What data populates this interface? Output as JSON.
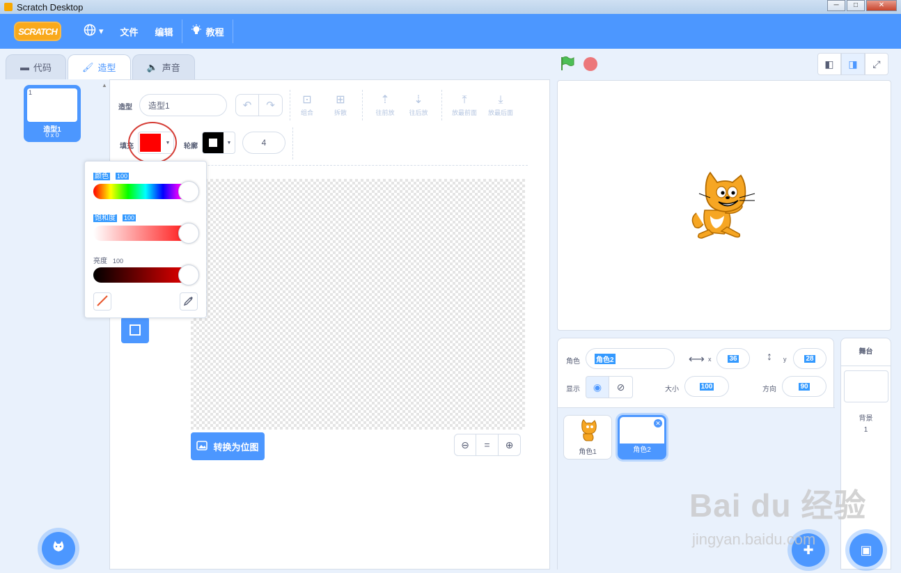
{
  "window": {
    "title": "Scratch Desktop",
    "controls": [
      "─",
      "□",
      "✕"
    ]
  },
  "menu": {
    "logo": "SCRATCH",
    "globe_caret": "▾",
    "file": "文件",
    "edit": "编辑",
    "tutorial": "教程"
  },
  "tabs": [
    {
      "label": "代码",
      "icon": "code-icon"
    },
    {
      "label": "造型",
      "icon": "brush-icon"
    },
    {
      "label": "声音",
      "icon": "speaker-icon"
    }
  ],
  "costumes": [
    {
      "num": "1",
      "name": "造型1",
      "size": "0 x 0"
    }
  ],
  "editor": {
    "costume_label": "造型",
    "costume_name": "造型1",
    "tools": [
      {
        "label": "组合",
        "icon": "group-icon"
      },
      {
        "label": "拆散",
        "icon": "ungroup-icon"
      },
      {
        "label": "往前放",
        "icon": "forward-icon"
      },
      {
        "label": "往后放",
        "icon": "backward-icon"
      },
      {
        "label": "放最前面",
        "icon": "front-icon"
      },
      {
        "label": "放最后面",
        "icon": "back-icon"
      }
    ],
    "fill_label": "填充",
    "fill_color": "#ff0000",
    "outline_label": "轮廓",
    "outline_color": "#000000",
    "outline_width": "4",
    "convert_button": "转换为位图",
    "zoom": {
      "out": "⊖",
      "reset": "=",
      "in": "⊕"
    }
  },
  "color_picker": {
    "hue_label": "颜色",
    "hue_value": "100",
    "saturation_label": "饱和度",
    "saturation_value": "100",
    "brightness_label": "亮度",
    "brightness_value": "100"
  },
  "sprite_info": {
    "sprite_label": "角色",
    "sprite_name": "角色2",
    "x_label": "x",
    "x_value": "36",
    "y_label": "y",
    "y_value": "28",
    "show_label": "显示",
    "size_label": "大小",
    "size_value": "100",
    "direction_label": "方向",
    "direction_value": "90"
  },
  "sprites": [
    {
      "name": "角色1",
      "selected": false
    },
    {
      "name": "角色2",
      "selected": true
    }
  ],
  "stage_pane": {
    "title": "舞台",
    "backdrop_label": "背景",
    "backdrop_count": "1"
  },
  "watermark": {
    "main": "Bai du 经验",
    "sub": "jingyan.baidu.com"
  }
}
